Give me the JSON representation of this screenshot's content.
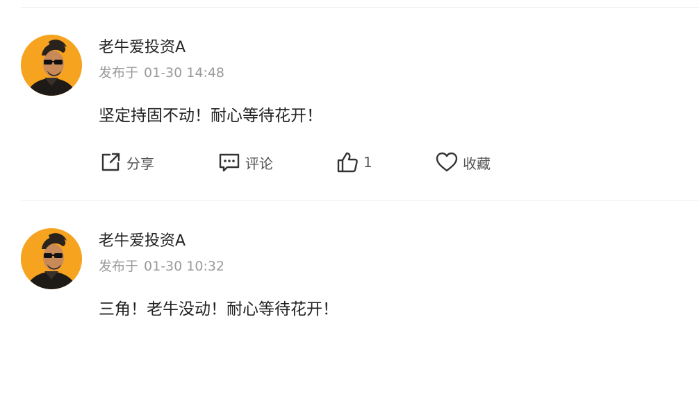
{
  "posts": [
    {
      "username": "老牛爱投资A",
      "published_prefix": "发布于",
      "published_time": "01-30 14:48",
      "content": "坚定持固不动！耐心等待花开！",
      "actions": {
        "share_label": "分享",
        "comment_label": "评论",
        "like_count": "1",
        "favorite_label": "收藏"
      }
    },
    {
      "username": "老牛爱投资A",
      "published_prefix": "发布于",
      "published_time": "01-30 10:32",
      "content": "三角！老牛没动！耐心等待花开！"
    }
  ],
  "icons": {
    "share": "share-icon",
    "comment": "comment-icon",
    "like": "thumbs-up-icon",
    "favorite": "heart-icon"
  },
  "colors": {
    "avatar_bg": "#f6a31f",
    "username": "#222222",
    "meta": "#9a9a9a",
    "content": "#222222",
    "action_label": "#555555",
    "divider": "#eeeeee"
  }
}
